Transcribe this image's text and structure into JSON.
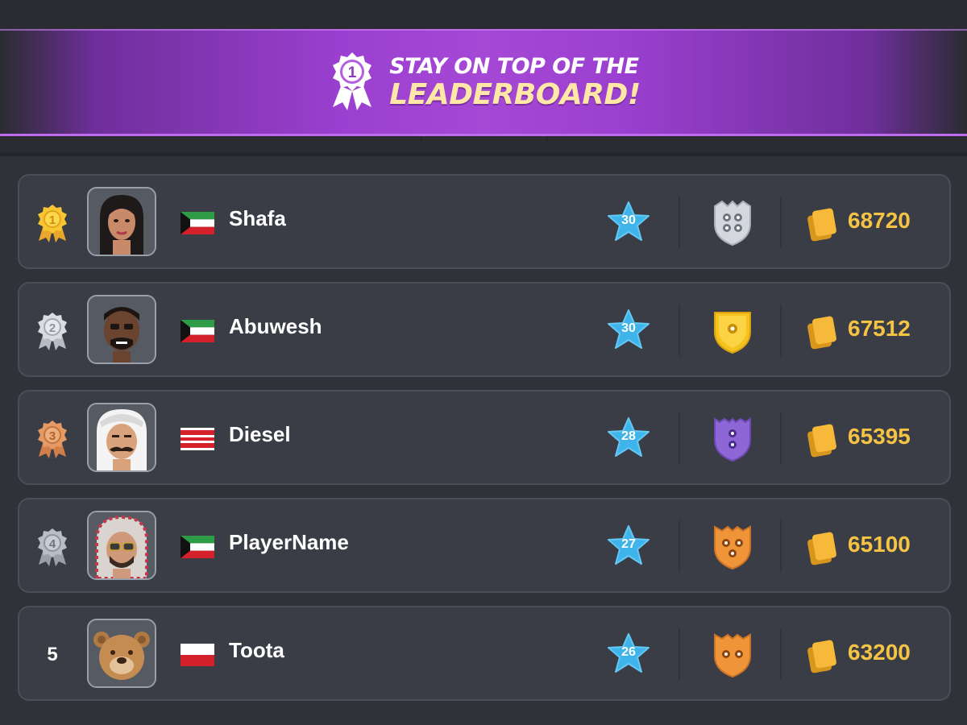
{
  "banner": {
    "line1": "STAY ON TOP OF THE",
    "line2": "LEADERBOARD!",
    "badge_number": "1",
    "icon": "rosette-icon"
  },
  "leaderboard": [
    {
      "rank": "1",
      "rank_style": "gold-medal",
      "name": "Shafa",
      "flag": "kuwait",
      "level": "30",
      "league": "silver-shield",
      "coins": "68720"
    },
    {
      "rank": "2",
      "rank_style": "silver-medal",
      "name": "Abuwesh",
      "flag": "kuwait",
      "level": "30",
      "league": "gold-shield",
      "coins": "67512"
    },
    {
      "rank": "3",
      "rank_style": "bronze-medal",
      "name": "Diesel",
      "flag": "bahrain",
      "level": "28",
      "league": "purple-shield",
      "coins": "65395"
    },
    {
      "rank": "4",
      "rank_style": "grey-medal",
      "name": "PlayerName",
      "flag": "kuwait",
      "level": "27",
      "league": "orange-shield",
      "coins": "65100"
    },
    {
      "rank": "5",
      "rank_style": "plain",
      "name": "Toota",
      "flag": "bahrain",
      "level": "26",
      "league": "orange-shield",
      "coins": "63200"
    }
  ],
  "colors": {
    "background": "#2f3239",
    "row": "#3a3d45",
    "banner_purple": "#a648d6",
    "coin_gold": "#f6c445",
    "level_blue": "#3fb4ea"
  }
}
